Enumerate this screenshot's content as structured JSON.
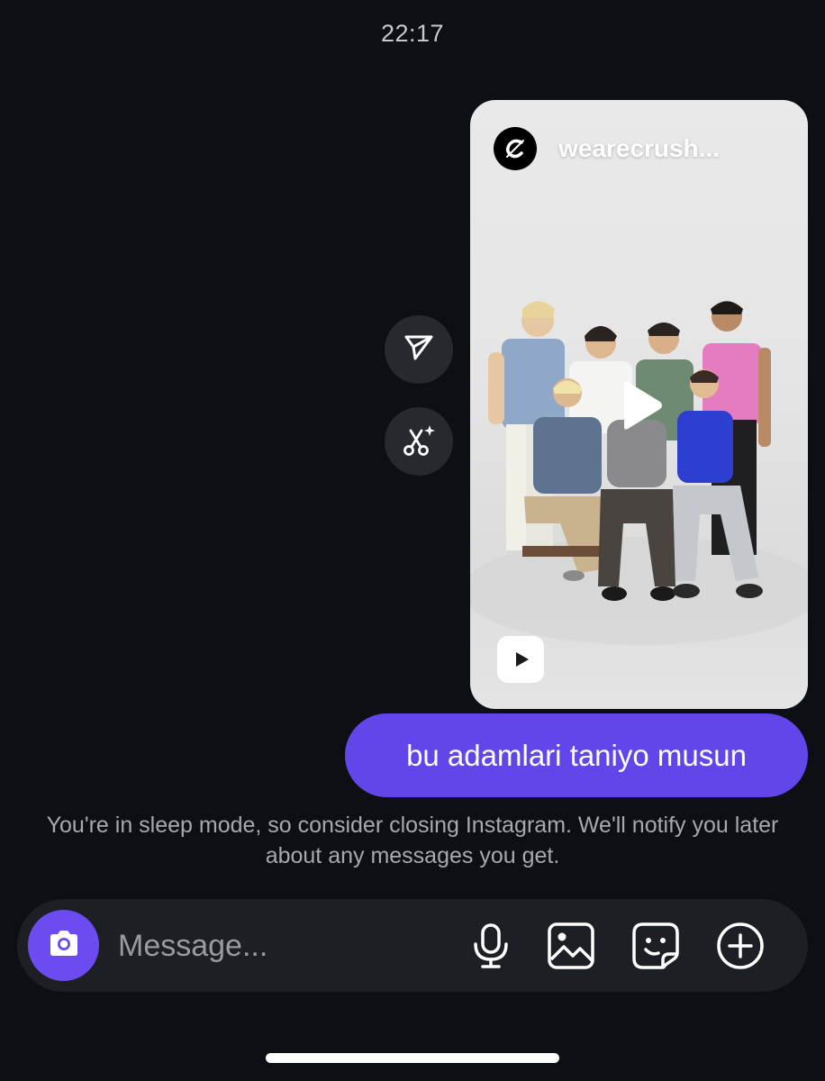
{
  "status_bar": {
    "time": "22:17"
  },
  "shared_reel": {
    "username": "wearecrush...",
    "avatar_icon": "crush-logo-icon",
    "play_icon": "play-icon",
    "badge_icon": "reels-icon"
  },
  "side_actions": {
    "forward_icon": "send-icon",
    "remix_icon": "scissors-sparkle-icon"
  },
  "sent_message": {
    "text": "bu adamlari taniyo musun"
  },
  "sleep_notice": {
    "text": "You're in sleep mode, so consider closing Instagram. We'll notify you later about any messages you get."
  },
  "composer": {
    "placeholder": "Message...",
    "camera_icon": "camera-icon",
    "mic_icon": "microphone-icon",
    "gallery_icon": "gallery-icon",
    "sticker_icon": "sticker-icon",
    "plus_icon": "plus-circle-icon"
  },
  "colors": {
    "background": "#0c1014",
    "accent": "#6246ea",
    "camera_button": "#6c4cf0",
    "composer_bg": "#1c1f24",
    "muted_text": "#a8a8ad"
  }
}
